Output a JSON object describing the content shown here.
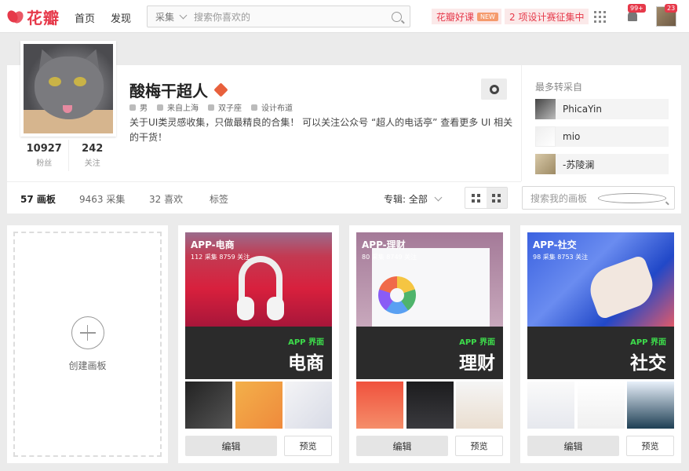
{
  "header": {
    "logo_text": "花瓣",
    "nav": [
      "首页",
      "发现"
    ],
    "search": {
      "category": "采集",
      "placeholder": "搜索你喜欢的"
    },
    "promo1": {
      "label": "花瓣好课",
      "badge": "NEW"
    },
    "promo2": "2 项设计赛征集中",
    "notification_count": "99+",
    "avatar_count": "23"
  },
  "profile": {
    "name": "酸梅干超人",
    "meta": [
      "男",
      "来自上海",
      "双子座",
      "设计布道"
    ],
    "bio": "关于UI类灵感收集，只做最精良的合集！ 可以关注公众号 “超人的电话亭” 查看更多 UI 相关的干货！",
    "stats": [
      {
        "n": "10927",
        "l": "粉丝"
      },
      {
        "n": "242",
        "l": "关注"
      }
    ],
    "repin": {
      "title": "最多转采自",
      "users": [
        "PhicaYin",
        "mio",
        "-苏陵澜"
      ]
    }
  },
  "tabs": [
    {
      "label": "57 画板",
      "active": true
    },
    {
      "label": "9463 采集"
    },
    {
      "label": "32 喜欢"
    },
    {
      "label": "标签"
    }
  ],
  "filter_label": "专辑: 全部",
  "board_search_placeholder": "搜索我的画板",
  "create_label": "创建画板",
  "boards": [
    {
      "title": "APP-电商",
      "stats": "112 采集  8759 关注",
      "tag": "APP 界面",
      "big": "电商",
      "edit": "编辑",
      "preview": "预览"
    },
    {
      "title": "APP-理财",
      "stats": "80 采集  8749 关注",
      "tag": "APP 界面",
      "big": "理财",
      "edit": "编辑",
      "preview": "预览"
    },
    {
      "title": "APP-社交",
      "stats": "98 采集  8753 关注",
      "tag": "APP 界面",
      "big": "社交",
      "edit": "编辑",
      "preview": "预览"
    }
  ],
  "colors": {
    "brand": "#e6394a",
    "accent_green": "#3ddc4b"
  }
}
